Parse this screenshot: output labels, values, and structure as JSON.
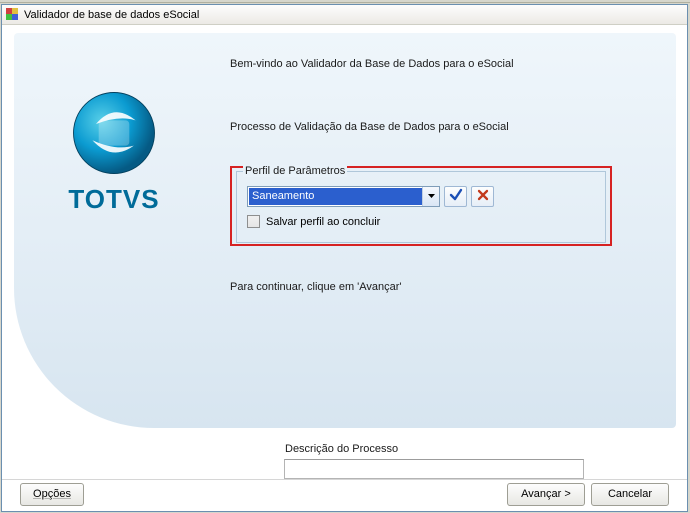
{
  "window": {
    "title": "Validador de base de dados eSocial"
  },
  "main": {
    "logo_text": "TOTVS",
    "welcome": "Bem-vindo ao Validador da Base de Dados para o eSocial",
    "process_text": "Processo de Validação da Base de Dados para o eSocial",
    "continue_text": "Para continuar, clique em 'Avançar'"
  },
  "params": {
    "legend": "Perfil de Parâmetros",
    "combo_value": "Saneamento",
    "confirm_icon": "check-icon",
    "cancel_icon": "x-icon",
    "save_checkbox_label": "Salvar perfil ao concluir",
    "save_checkbox_checked": false
  },
  "description": {
    "label": "Descrição do Processo",
    "value": ""
  },
  "buttons": {
    "options": "Opções",
    "next": "Avançar  >",
    "cancel": "Cancelar"
  },
  "colors": {
    "highlight_border": "#d62222",
    "brand_primary": "#006b99",
    "selection_bg": "#2b5fce"
  }
}
